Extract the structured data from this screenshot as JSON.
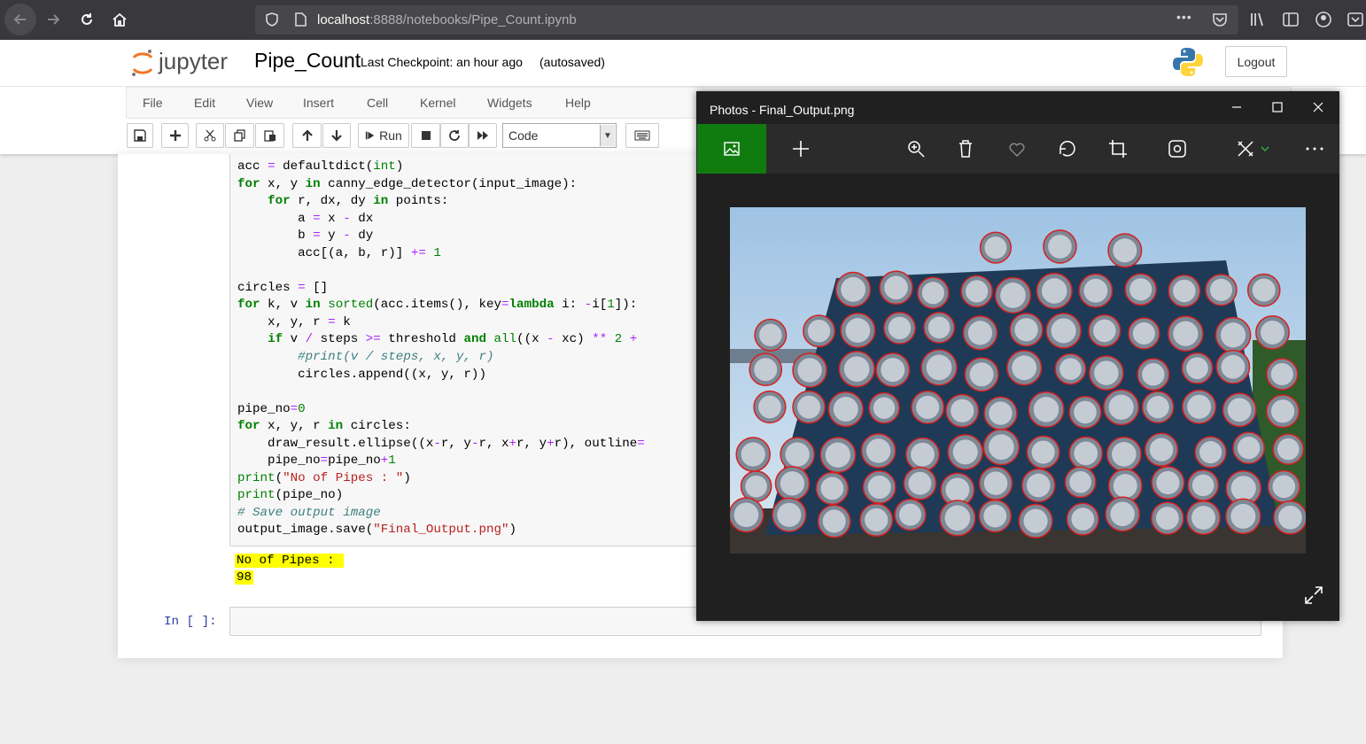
{
  "browser": {
    "url_host": "localhost",
    "url_rest": ":8888/notebooks/Pipe_Count.ipynb",
    "more": "•••"
  },
  "jupyter": {
    "logo_text": "jupyter",
    "notebook_name": "Pipe_Count",
    "checkpoint": "Last Checkpoint: an hour ago",
    "autosave": "(autosaved)",
    "logout": "Logout"
  },
  "menu": [
    "File",
    "Edit",
    "View",
    "Insert",
    "Cell",
    "Kernel",
    "Widgets",
    "Help"
  ],
  "toolbar": {
    "run_label": "Run",
    "cell_type": "Code"
  },
  "cell": {
    "output_line1": "No of Pipes : ",
    "output_line2": "98",
    "in_prompt": "In [ ]:"
  },
  "photos": {
    "title": "Photos - Final_Output.png",
    "accent": "#107c10"
  }
}
